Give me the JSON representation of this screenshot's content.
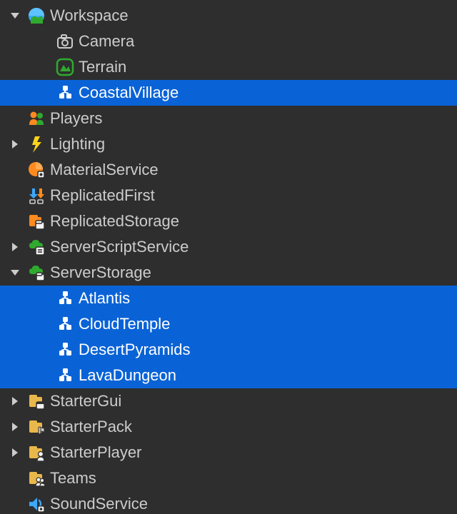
{
  "colors": {
    "bg": "#2e2e2e",
    "text": "#cccccc",
    "selectedBg": "#0a63d6",
    "selectedText": "#ffffff"
  },
  "tree": [
    {
      "id": "workspace",
      "label": "Workspace",
      "depth": 0,
      "arrow": "down",
      "icon": "workspace-icon",
      "selected": false
    },
    {
      "id": "camera",
      "label": "Camera",
      "depth": 1,
      "arrow": "none",
      "icon": "camera-icon",
      "selected": false
    },
    {
      "id": "terrain",
      "label": "Terrain",
      "depth": 1,
      "arrow": "none",
      "icon": "terrain-icon",
      "selected": false
    },
    {
      "id": "coastalvillage",
      "label": "CoastalVillage",
      "depth": 1,
      "arrow": "none",
      "icon": "model-icon",
      "selected": true
    },
    {
      "id": "players",
      "label": "Players",
      "depth": 0,
      "arrow": "none",
      "icon": "players-icon",
      "selected": false
    },
    {
      "id": "lighting",
      "label": "Lighting",
      "depth": 0,
      "arrow": "right",
      "icon": "lighting-icon",
      "selected": false
    },
    {
      "id": "materialservice",
      "label": "MaterialService",
      "depth": 0,
      "arrow": "none",
      "icon": "material-icon",
      "selected": false
    },
    {
      "id": "replicatedfirst",
      "label": "ReplicatedFirst",
      "depth": 0,
      "arrow": "none",
      "icon": "replicatedfirst-icon",
      "selected": false
    },
    {
      "id": "replicatedstorage",
      "label": "ReplicatedStorage",
      "depth": 0,
      "arrow": "none",
      "icon": "replicatedstorage-icon",
      "selected": false
    },
    {
      "id": "serverscript",
      "label": "ServerScriptService",
      "depth": 0,
      "arrow": "right",
      "icon": "serverscript-icon",
      "selected": false
    },
    {
      "id": "serverstorage",
      "label": "ServerStorage",
      "depth": 0,
      "arrow": "down",
      "icon": "serverstorage-icon",
      "selected": false
    },
    {
      "id": "atlantis",
      "label": "Atlantis",
      "depth": 1,
      "arrow": "none",
      "icon": "model-icon",
      "selected": true
    },
    {
      "id": "cloudtemple",
      "label": "CloudTemple",
      "depth": 1,
      "arrow": "none",
      "icon": "model-icon",
      "selected": true
    },
    {
      "id": "desertpyramids",
      "label": "DesertPyramids",
      "depth": 1,
      "arrow": "none",
      "icon": "model-icon",
      "selected": true
    },
    {
      "id": "lavadungeon",
      "label": "LavaDungeon",
      "depth": 1,
      "arrow": "none",
      "icon": "model-icon",
      "selected": true
    },
    {
      "id": "startergui",
      "label": "StarterGui",
      "depth": 0,
      "arrow": "right",
      "icon": "startergui-icon",
      "selected": false
    },
    {
      "id": "starterpack",
      "label": "StarterPack",
      "depth": 0,
      "arrow": "right",
      "icon": "starterpack-icon",
      "selected": false
    },
    {
      "id": "starterplayer",
      "label": "StarterPlayer",
      "depth": 0,
      "arrow": "right",
      "icon": "starterplayer-icon",
      "selected": false
    },
    {
      "id": "teams",
      "label": "Teams",
      "depth": 0,
      "arrow": "none",
      "icon": "teams-icon",
      "selected": false
    },
    {
      "id": "soundservice",
      "label": "SoundService",
      "depth": 0,
      "arrow": "none",
      "icon": "sound-icon",
      "selected": false
    }
  ]
}
